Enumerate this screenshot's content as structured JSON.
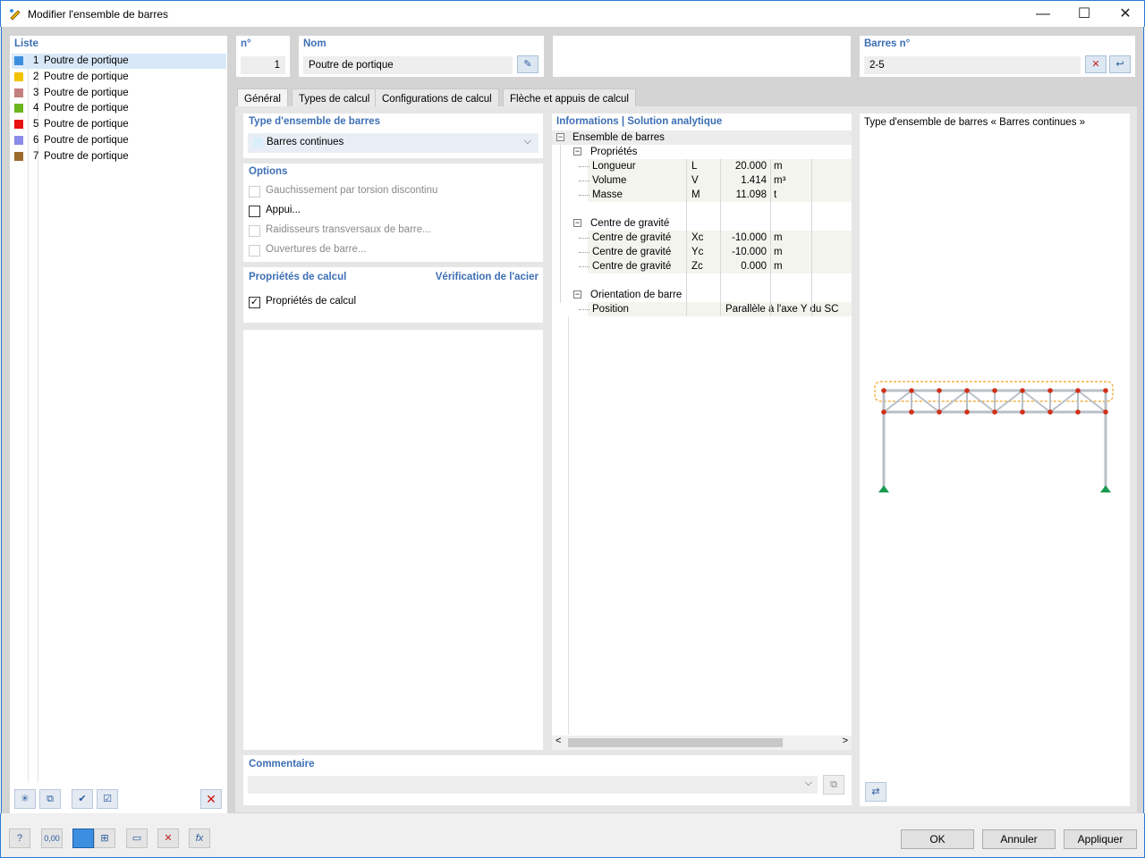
{
  "window": {
    "title": "Modifier l'ensemble de barres",
    "minimize": "—",
    "maximize": "☐",
    "close": "✕"
  },
  "list": {
    "label": "Liste",
    "items": [
      {
        "num": "1",
        "label": "Poutre de portique",
        "color": "#3c8fe0"
      },
      {
        "num": "2",
        "label": "Poutre de portique",
        "color": "#f2c200"
      },
      {
        "num": "3",
        "label": "Poutre de portique",
        "color": "#c47f7f"
      },
      {
        "num": "4",
        "label": "Poutre de portique",
        "color": "#6db51f"
      },
      {
        "num": "5",
        "label": "Poutre de portique",
        "color": "#e81010"
      },
      {
        "num": "6",
        "label": "Poutre de portique",
        "color": "#8a8ae8"
      },
      {
        "num": "7",
        "label": "Poutre de portique",
        "color": "#9c6b2e"
      }
    ]
  },
  "header": {
    "no_label": "n°",
    "no_value": "1",
    "name_label": "Nom",
    "name_value": "Poutre de portique",
    "members_label": "Barres n°",
    "members_value": "2-5"
  },
  "tabs": [
    "Général",
    "Types de calcul",
    "Configurations de calcul",
    "Flèche et appuis de calcul"
  ],
  "type_section": {
    "label": "Type d'ensemble de barres",
    "value": "Barres continues",
    "swatch": "#d9eefa"
  },
  "options": {
    "label": "Options",
    "items": [
      {
        "label": "Gauchissement par torsion discontinu",
        "checked": false,
        "enabled": false
      },
      {
        "label": "Appui...",
        "checked": false,
        "enabled": true
      },
      {
        "label": "Raidisseurs transversaux de barre...",
        "checked": false,
        "enabled": false
      },
      {
        "label": "Ouvertures de barre...",
        "checked": false,
        "enabled": false
      }
    ]
  },
  "calc_props": {
    "label": "Propriétés de calcul",
    "link": "Vérification de l'acier",
    "checkbox_label": "Propriétés de calcul",
    "checked": true
  },
  "info": {
    "label": "Informations | Solution analytique",
    "root": "Ensemble de barres",
    "groups": [
      {
        "title": "Propriétés",
        "rows": [
          {
            "name": "Longueur",
            "sym": "L",
            "val": "20.000",
            "unit": "m"
          },
          {
            "name": "Volume",
            "sym": "V",
            "val": "1.414",
            "unit": "m³"
          },
          {
            "name": "Masse",
            "sym": "M",
            "val": "11.098",
            "unit": "t"
          }
        ]
      },
      {
        "title": "Centre de gravité",
        "rows": [
          {
            "name": "Centre de gravité",
            "sym": "Xc",
            "val": "-10.000",
            "unit": "m"
          },
          {
            "name": "Centre de gravité",
            "sym": "Yc",
            "val": "-10.000",
            "unit": "m"
          },
          {
            "name": "Centre de gravité",
            "sym": "Zc",
            "val": "0.000",
            "unit": "m"
          }
        ]
      },
      {
        "title": "Orientation de barre",
        "rows": [
          {
            "name": "Position",
            "sym": "",
            "val": "Parallèle à l'axe Y du SC",
            "unit": ""
          }
        ]
      }
    ]
  },
  "preview": {
    "title": "Type d'ensemble de barres « Barres continues »"
  },
  "comment": {
    "label": "Commentaire",
    "value": ""
  },
  "buttons": {
    "ok": "OK",
    "cancel": "Annuler",
    "apply": "Appliquer"
  },
  "toolbar": {
    "value_icon_text": "0,00"
  }
}
